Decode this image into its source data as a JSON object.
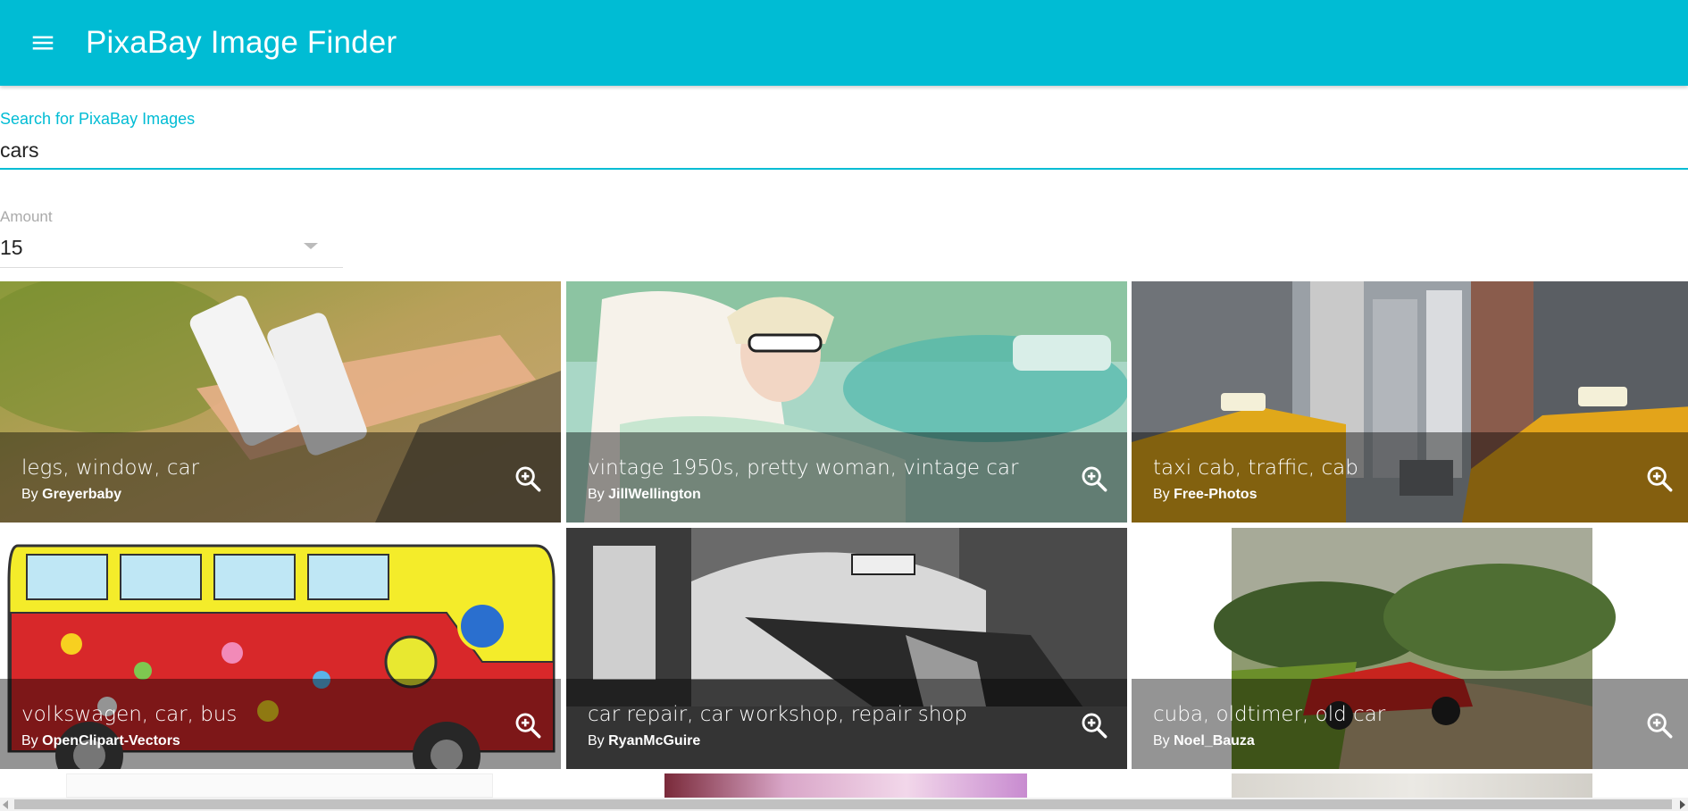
{
  "appbar": {
    "title": "PixaBay Image Finder",
    "menu_icon": "menu-icon",
    "color": "#00bcd4"
  },
  "search": {
    "label": "Search for PixaBay Images",
    "value": "cars"
  },
  "amount": {
    "label": "Amount",
    "value": "15"
  },
  "tiles": [
    {
      "title": "legs, window, car",
      "by_prefix": "By",
      "author": "Greyerbaby"
    },
    {
      "title": "vintage 1950s, pretty woman, vintage car",
      "by_prefix": "By",
      "author": "JillWellington"
    },
    {
      "title": "taxi cab, traffic, cab",
      "by_prefix": "By",
      "author": "Free-Photos"
    },
    {
      "title": "volkswagen, car, bus",
      "by_prefix": "By",
      "author": "OpenClipart-Vectors"
    },
    {
      "title": "car repair, car workshop, repair shop",
      "by_prefix": "By",
      "author": "RyanMcGuire"
    },
    {
      "title": "cuba, oldtimer, old car",
      "by_prefix": "By",
      "author": "Noel_Bauza"
    }
  ],
  "zoom_icon": "zoom-in-icon"
}
